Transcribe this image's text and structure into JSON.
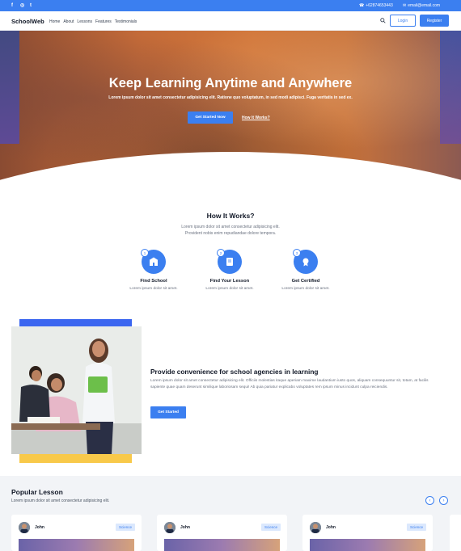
{
  "topbar": {
    "social": [
      "f",
      "◎",
      "t"
    ],
    "phone": "+62874653443",
    "email": "email@email.com"
  },
  "nav": {
    "logo": "SchoolWeb",
    "items": [
      "Home",
      "About",
      "Lessons",
      "Features",
      "Testimonials"
    ],
    "login_label": "Login",
    "register_label": "Register"
  },
  "hero": {
    "title": "Keep Learning Anytime and Anywhere",
    "subtitle": "Lorem ipsum dolor sit amet consectetur adipisicing elit. Ratione quo voluptatum, in sed modi adipisci. Fuga veritatis in sed ex.",
    "primary_button": "Get Started Now",
    "secondary_link": "How It Works?"
  },
  "how": {
    "title": "How It Works?",
    "desc_line1": "Lorem ipsum dolor sit amet consectetur adipisicing elit.",
    "desc_line2": "Provident nobis enim repudiandae dolore tempora.",
    "steps": [
      {
        "num": "1",
        "title": "Find School",
        "desc": "Lorem ipsum dolor sit amet.",
        "icon": "school-icon"
      },
      {
        "num": "2",
        "title": "Find Your Lesson",
        "desc": "Lorem ipsum dolor sit amet.",
        "icon": "book-icon"
      },
      {
        "num": "3",
        "title": "Get Certified",
        "desc": "Lorem ipsum dolor sit amet.",
        "icon": "certificate-icon"
      }
    ]
  },
  "convenience": {
    "title": "Provide convenience for school agencies in learning",
    "desc": "Lorem ipsum dolor sit amet consectetur adipisicing elit. Officiis molestias itaque aperiam maxime laudantium iusto quos, aliquam consequuntur sit, totam, at facilis sapiente quae quam deserunt similique laboriosam sequi! Ab quia pariatur explicabo voluptates rem ipsum minus incidunt culpa reiciendis.",
    "button": "Get Started"
  },
  "popular": {
    "title": "Popular Lesson",
    "desc": "Lorem ipsum dolor sit amet consectetur adipisicing elit.",
    "prev": "‹",
    "next": "›",
    "cards": [
      {
        "author": "John",
        "tag": "Science"
      },
      {
        "author": "John",
        "tag": "Science"
      },
      {
        "author": "John",
        "tag": "Science"
      }
    ]
  },
  "colors": {
    "accent": "#3b7ff0",
    "yellow": "#f8c94a",
    "hero_orange": "#d2773a"
  }
}
